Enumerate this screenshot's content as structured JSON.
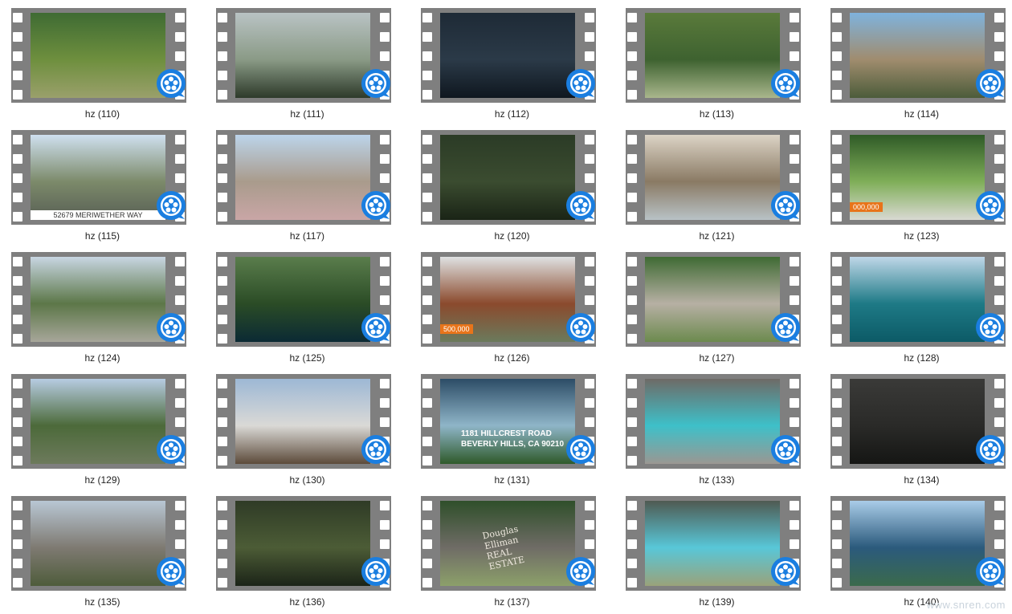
{
  "items": [
    {
      "label": "hz (110)",
      "colors": [
        "#3f6b33",
        "#6e8f3e",
        "#9aa06b"
      ],
      "overlay": ""
    },
    {
      "label": "hz (111)",
      "colors": [
        "#b9c3c4",
        "#8a9a86",
        "#2d3a2a"
      ],
      "overlay": ""
    },
    {
      "label": "hz (112)",
      "colors": [
        "#1e2a36",
        "#2b3a48",
        "#0f171f"
      ],
      "overlay": ""
    },
    {
      "label": "hz (113)",
      "colors": [
        "#5a7a3b",
        "#3e6230",
        "#a9b68c"
      ],
      "overlay": ""
    },
    {
      "label": "hz (114)",
      "colors": [
        "#7fb3dd",
        "#a08c6e",
        "#4c5c3a"
      ],
      "overlay": ""
    },
    {
      "label": "hz (115)",
      "colors": [
        "#cfe0ef",
        "#7c8a6a",
        "#585f55"
      ],
      "overlay": "52679 MERIWETHER WAY"
    },
    {
      "label": "hz (117)",
      "colors": [
        "#bcd4ea",
        "#a99b8c",
        "#c9a6a6"
      ],
      "overlay": ""
    },
    {
      "label": "hz (120)",
      "colors": [
        "#2b3b26",
        "#3b4c30",
        "#1a2416"
      ],
      "overlay": ""
    },
    {
      "label": "hz (121)",
      "colors": [
        "#dcd4c6",
        "#8a7a64",
        "#b8c2c6"
      ],
      "overlay": ""
    },
    {
      "label": "hz (123)",
      "colors": [
        "#2f5a27",
        "#7fae58",
        "#d9d9d2"
      ],
      "overlay": "000,000"
    },
    {
      "label": "hz (124)",
      "colors": [
        "#c8d6e2",
        "#5c7748",
        "#a7a69a"
      ],
      "overlay": ""
    },
    {
      "label": "hz (125)",
      "colors": [
        "#5a7d4c",
        "#2b4c26",
        "#0b2a34"
      ],
      "overlay": ""
    },
    {
      "label": "hz (126)",
      "colors": [
        "#dfe1e2",
        "#8b4a2d",
        "#6b7a5c"
      ],
      "overlay": "500,000"
    },
    {
      "label": "hz (127)",
      "colors": [
        "#3f6a33",
        "#b7b0a4",
        "#6c8a4e"
      ],
      "overlay": ""
    },
    {
      "label": "hz (128)",
      "colors": [
        "#bfd7e8",
        "#1e7a86",
        "#0c5a66"
      ],
      "overlay": ""
    },
    {
      "label": "hz (129)",
      "colors": [
        "#b7cce2",
        "#4c6a3a",
        "#6d7a5c"
      ],
      "overlay": ""
    },
    {
      "label": "hz (130)",
      "colors": [
        "#9db8d5",
        "#dad9d6",
        "#5c4a3a"
      ],
      "overlay": ""
    },
    {
      "label": "hz (131)",
      "colors": [
        "#2c4c66",
        "#8fb5c8",
        "#2f5a2a"
      ],
      "overlay": "1181 HILLCREST ROAD BEVERLY HILLS, CA 90210"
    },
    {
      "label": "hz (133)",
      "colors": [
        "#6e6a66",
        "#3ec0c9",
        "#9b9792"
      ],
      "overlay": ""
    },
    {
      "label": "hz (134)",
      "colors": [
        "#3a3a38",
        "#2a2a28",
        "#151614"
      ],
      "overlay": ""
    },
    {
      "label": "hz (135)",
      "colors": [
        "#b9c7d4",
        "#7e7a72",
        "#4f5c3b"
      ],
      "overlay": ""
    },
    {
      "label": "hz (136)",
      "colors": [
        "#2f3b26",
        "#4c5c36",
        "#1c2418"
      ],
      "overlay": ""
    },
    {
      "label": "hz (137)",
      "colors": [
        "#2f4f2a",
        "#6f6c66",
        "#8ca06a"
      ],
      "overlay": "Douglas Elliman REAL ESTATE"
    },
    {
      "label": "hz (139)",
      "colors": [
        "#4f5a52",
        "#58c7d8",
        "#9aa27a"
      ],
      "overlay": ""
    },
    {
      "label": "hz (140)",
      "colors": [
        "#a9cce8",
        "#2b5a7c",
        "#3b6a4c"
      ],
      "overlay": ""
    }
  ],
  "watermark": "www.snren.com",
  "icon": {
    "name": "video-player-badge-icon",
    "color": "#1a7ee0"
  }
}
